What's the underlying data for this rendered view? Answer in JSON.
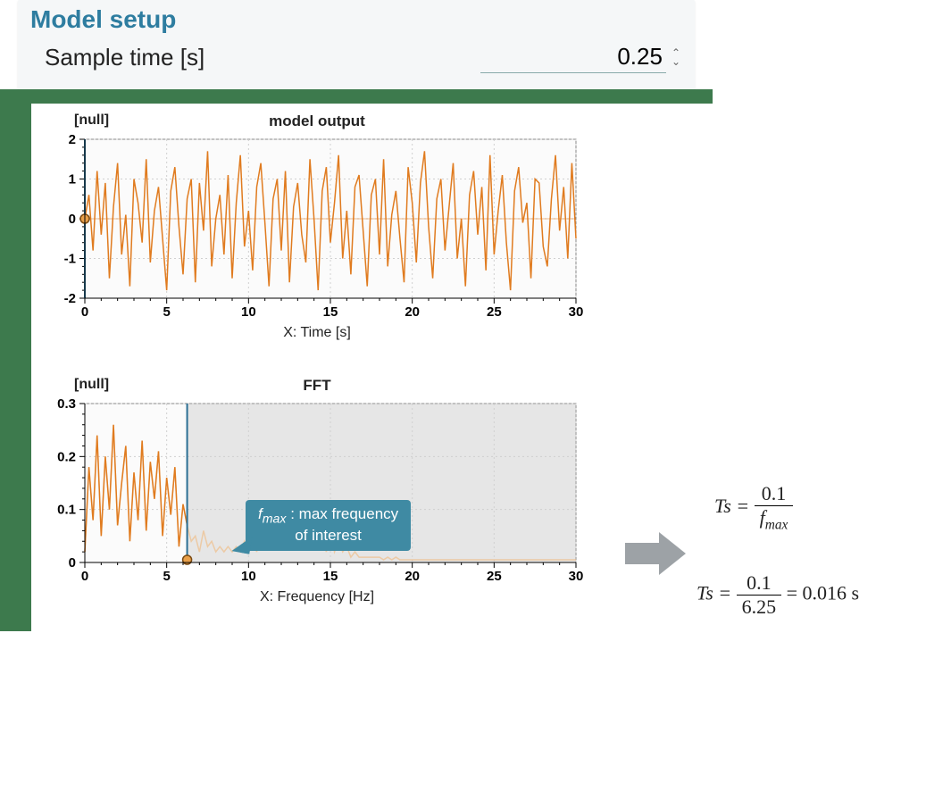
{
  "panel": {
    "title": "Model setup",
    "sample_time_label": "Sample time [s]",
    "sample_time_value": "0.25"
  },
  "chart1": {
    "unit_label": "[null]",
    "title": "model output",
    "xlabel": "X: Time [s]"
  },
  "chart2": {
    "unit_label": "[null]",
    "title": "FFT",
    "xlabel": "X: Frequency [Hz]"
  },
  "callout": {
    "line1_prefix_var": "f",
    "line1_prefix_sub": "max",
    "line1_tail": " : max frequency",
    "line2": "of interest"
  },
  "formulae": {
    "eq1_lhs": "Ts = ",
    "eq1_top": "0.1",
    "eq1_bot_var": "f",
    "eq1_bot_sub": "max",
    "eq2_lhs": "Ts = ",
    "eq2_top": "0.1",
    "eq2_bot": "6.25",
    "eq2_rhs": " = 0.016 s"
  },
  "chart_data": [
    {
      "type": "line",
      "title": "model output",
      "xlabel": "X: Time [s]",
      "ylabel": "[null]",
      "xlim": [
        0,
        30
      ],
      "ylim": [
        -2,
        2
      ],
      "x_ticks": [
        0,
        5,
        10,
        15,
        20,
        25,
        30
      ],
      "y_ticks": [
        -2,
        -1,
        0,
        1,
        2
      ],
      "note": "Noisy time-domain signal oscillating roughly between -2 and 2. Values below are coarse visual estimates sampled at Δt≈0.25 s (≈120 points).",
      "x": [
        0,
        0.25,
        0.5,
        0.75,
        1,
        1.25,
        1.5,
        1.75,
        2,
        2.25,
        2.5,
        2.75,
        3,
        3.25,
        3.5,
        3.75,
        4,
        4.25,
        4.5,
        4.75,
        5,
        5.25,
        5.5,
        5.75,
        6,
        6.25,
        6.5,
        6.75,
        7,
        7.25,
        7.5,
        7.75,
        8,
        8.25,
        8.5,
        8.75,
        9,
        9.25,
        9.5,
        9.75,
        10,
        10.25,
        10.5,
        10.75,
        11,
        11.25,
        11.5,
        11.75,
        12,
        12.25,
        12.5,
        12.75,
        13,
        13.25,
        13.5,
        13.75,
        14,
        14.25,
        14.5,
        14.75,
        15,
        15.25,
        15.5,
        15.75,
        16,
        16.25,
        16.5,
        16.75,
        17,
        17.25,
        17.5,
        17.75,
        18,
        18.25,
        18.5,
        18.75,
        19,
        19.25,
        19.5,
        19.75,
        20,
        20.25,
        20.5,
        20.75,
        21,
        21.25,
        21.5,
        21.75,
        22,
        22.25,
        22.5,
        22.75,
        23,
        23.25,
        23.5,
        23.75,
        24,
        24.25,
        24.5,
        24.75,
        25,
        25.25,
        25.5,
        25.75,
        26,
        26.25,
        26.5,
        26.75,
        27,
        27.25,
        27.5,
        27.75,
        28,
        28.25,
        28.5,
        28.75,
        29,
        29.25,
        29.5,
        29.75,
        30
      ],
      "y": [
        0,
        0.6,
        -0.8,
        1.2,
        -0.4,
        0.9,
        -1.5,
        0.3,
        1.4,
        -0.9,
        0.1,
        -1.7,
        1.0,
        0.4,
        -0.6,
        1.5,
        -1.1,
        0.2,
        0.8,
        -0.5,
        -1.8,
        0.7,
        1.3,
        -0.2,
        -1.4,
        0.5,
        1.0,
        -1.6,
        0.9,
        -0.3,
        1.7,
        -1.2,
        0.0,
        0.6,
        -0.9,
        1.1,
        -1.5,
        0.4,
        1.6,
        -0.7,
        0.2,
        -1.3,
        0.8,
        1.4,
        -0.1,
        -1.7,
        0.5,
        1.0,
        -0.8,
        1.2,
        -1.6,
        0.3,
        0.9,
        -0.4,
        -1.1,
        1.5,
        0.0,
        -1.8,
        0.7,
        1.3,
        -0.6,
        0.4,
        1.6,
        -1.0,
        0.2,
        -1.4,
        0.8,
        1.1,
        -0.3,
        -1.7,
        0.6,
        1.0,
        -0.9,
        1.5,
        -1.2,
        0.1,
        0.7,
        -0.5,
        -1.6,
        1.3,
        0.4,
        -1.1,
        0.9,
        1.7,
        -0.2,
        -1.5,
        0.5,
        1.0,
        -0.8,
        0.3,
        1.4,
        -1.0,
        0.0,
        -1.7,
        0.6,
        1.2,
        -0.4,
        0.8,
        -1.3,
        1.6,
        -0.9,
        0.2,
        1.1,
        -0.6,
        -1.8,
        0.7,
        1.3,
        -0.1,
        0.4,
        -1.5,
        1.0,
        0.9,
        -0.7,
        -1.2,
        0.5,
        1.6,
        -0.3,
        0.8,
        -1.0,
        1.4,
        -0.5
      ],
      "cursor_x": 0
    },
    {
      "type": "line",
      "title": "FFT",
      "xlabel": "X: Frequency [Hz]",
      "ylabel": "[null]",
      "xlim": [
        0,
        30
      ],
      "ylim": [
        0,
        0.3
      ],
      "x_ticks": [
        0,
        5,
        10,
        15,
        20,
        25,
        30
      ],
      "y_ticks": [
        0.0,
        0.1,
        0.2,
        0.3
      ],
      "note": "FFT magnitude spectrum. Significant energy below ≈6.25 Hz (highlighted as f_max), small lobe ~10–16 Hz, near zero beyond. Values are coarse visual estimates sampled at Δf≈0.25 Hz.",
      "x": [
        0,
        0.25,
        0.5,
        0.75,
        1,
        1.25,
        1.5,
        1.75,
        2,
        2.25,
        2.5,
        2.75,
        3,
        3.25,
        3.5,
        3.75,
        4,
        4.25,
        4.5,
        4.75,
        5,
        5.25,
        5.5,
        5.75,
        6,
        6.25,
        6.5,
        6.75,
        7,
        7.25,
        7.5,
        7.75,
        8,
        8.25,
        8.5,
        8.75,
        9,
        9.25,
        9.5,
        9.75,
        10,
        10.25,
        10.5,
        10.75,
        11,
        11.25,
        11.5,
        11.75,
        12,
        12.25,
        12.5,
        12.75,
        13,
        13.25,
        13.5,
        13.75,
        14,
        14.25,
        14.5,
        14.75,
        15,
        15.25,
        15.5,
        15.75,
        16,
        16.25,
        16.5,
        16.75,
        17,
        17.25,
        17.5,
        17.75,
        18,
        18.25,
        18.5,
        18.75,
        19,
        19.25,
        19.5,
        19.75,
        20,
        20.25,
        20.5,
        20.75,
        21,
        21.25,
        21.5,
        21.75,
        22,
        22.25,
        22.5,
        22.75,
        23,
        23.25,
        23.5,
        23.75,
        24,
        24.25,
        24.5,
        24.75,
        25,
        25.25,
        25.5,
        25.75,
        26,
        26.25,
        26.5,
        26.75,
        27,
        27.25,
        27.5,
        27.75,
        28,
        28.25,
        28.5,
        28.75,
        29,
        29.25,
        29.5,
        29.75,
        30
      ],
      "y": [
        0.02,
        0.18,
        0.08,
        0.24,
        0.05,
        0.2,
        0.1,
        0.26,
        0.07,
        0.15,
        0.22,
        0.04,
        0.17,
        0.08,
        0.23,
        0.06,
        0.19,
        0.12,
        0.21,
        0.05,
        0.16,
        0.09,
        0.18,
        0.03,
        0.11,
        0.07,
        0.04,
        0.05,
        0.02,
        0.06,
        0.03,
        0.04,
        0.02,
        0.03,
        0.02,
        0.03,
        0.02,
        0.03,
        0.02,
        0.04,
        0.02,
        0.05,
        0.02,
        0.06,
        0.03,
        0.05,
        0.07,
        0.04,
        0.06,
        0.03,
        0.07,
        0.03,
        0.08,
        0.04,
        0.06,
        0.03,
        0.07,
        0.03,
        0.05,
        0.02,
        0.06,
        0.02,
        0.04,
        0.02,
        0.03,
        0.01,
        0.02,
        0.01,
        0.01,
        0.01,
        0.01,
        0.01,
        0.01,
        0.005,
        0.01,
        0.005,
        0.01,
        0.005,
        0.005,
        0.005,
        0.005,
        0.005,
        0.005,
        0.005,
        0.005,
        0.005,
        0.005,
        0.005,
        0.005,
        0.005,
        0.005,
        0.005,
        0.005,
        0.005,
        0.005,
        0.005,
        0.005,
        0.005,
        0.005,
        0.005,
        0.005,
        0.005,
        0.005,
        0.005,
        0.005,
        0.005,
        0.005,
        0.005,
        0.005,
        0.005,
        0.005,
        0.005,
        0.005,
        0.005,
        0.005,
        0.005,
        0.005,
        0.005,
        0.005,
        0.005,
        0.005
      ],
      "cursor_x": 6.25,
      "fmax": 6.25,
      "shaded_region": [
        6.25,
        30
      ]
    }
  ]
}
